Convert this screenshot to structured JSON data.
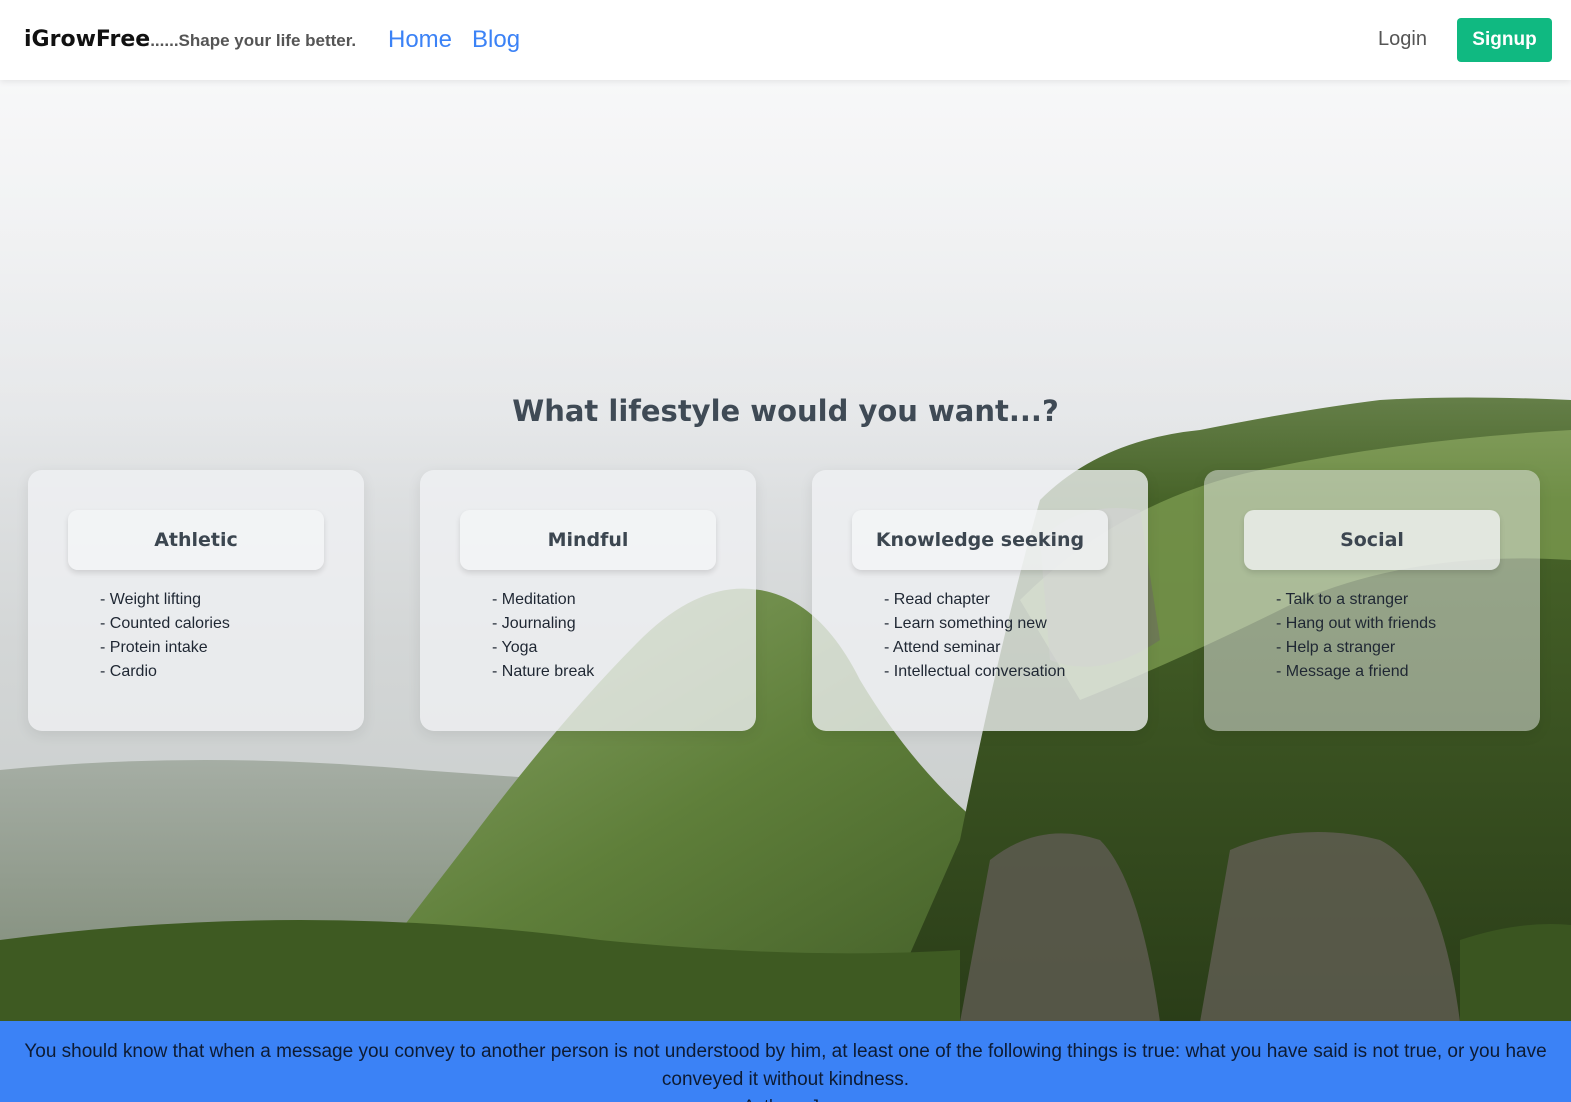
{
  "navbar": {
    "brand_name": "iGrowFree",
    "brand_tagline": "......Shape your life better.",
    "links": [
      {
        "label": "Home"
      },
      {
        "label": "Blog"
      }
    ],
    "login_label": "Login",
    "signup_label": "Signup"
  },
  "hero": {
    "headline": "What lifestyle would you want...?"
  },
  "cards": [
    {
      "title": "Athletic",
      "items": [
        "- Weight lifting",
        "- Counted calories",
        "- Protein intake",
        "- Cardio"
      ]
    },
    {
      "title": "Mindful",
      "items": [
        "- Meditation",
        "- Journaling",
        "- Yoga",
        "- Nature break"
      ]
    },
    {
      "title": "Knowledge seeking",
      "items": [
        "- Read chapter",
        "- Learn something new",
        "- Attend seminar",
        "- Intellectual conversation"
      ]
    },
    {
      "title": "Social",
      "items": [
        "- Talk to a stranger",
        "- Hang out with friends",
        "- Help a stranger",
        "- Message a friend"
      ]
    }
  ],
  "quote": {
    "text": "You should know that when a message you convey to another person is not understood by him, at least one of the following things is true: what you have said is not true, or you have conveyed it without kindness.",
    "author": "- Anthony Jay"
  },
  "colors": {
    "brand_green": "#10b981",
    "link_blue": "#3b82f6",
    "quote_bar": "#3b82f6"
  }
}
